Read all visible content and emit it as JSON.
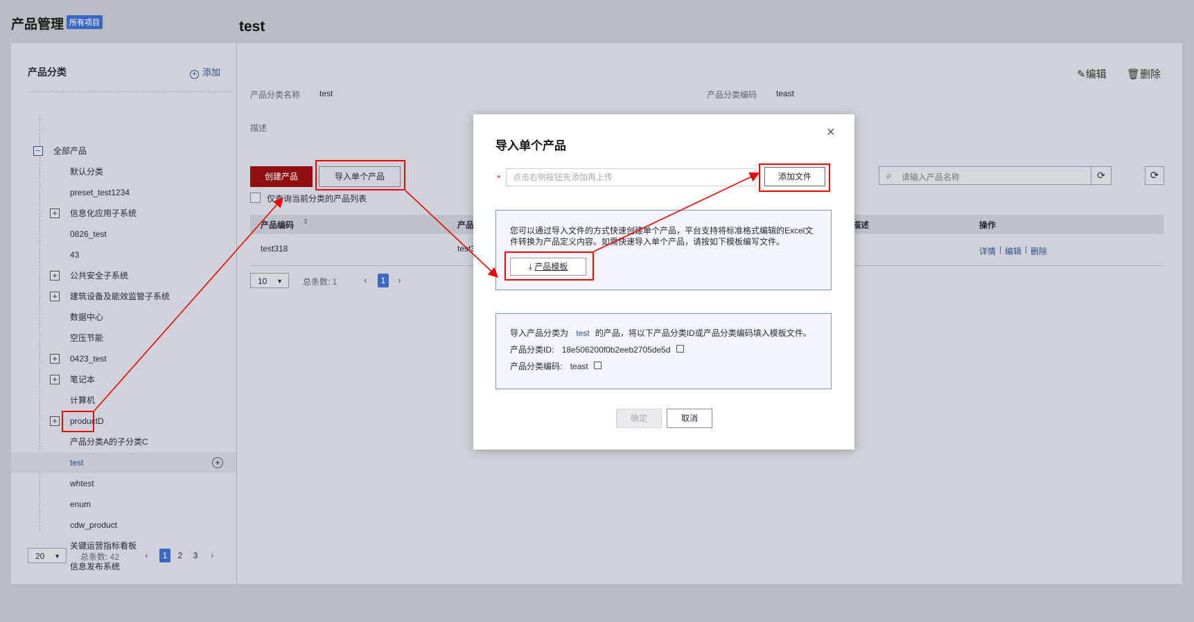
{
  "header": {
    "title": "产品管理",
    "badge": "所有项目"
  },
  "sidebar": {
    "title": "产品分类",
    "add_label": "添加",
    "tree": [
      {
        "label": "全部产品",
        "expander": "−",
        "root": true
      },
      {
        "label": "默认分类"
      },
      {
        "label": "preset_test1234"
      },
      {
        "label": "信息化应用子系统",
        "expander": "+"
      },
      {
        "label": "0826_test"
      },
      {
        "label": "43"
      },
      {
        "label": "公共安全子系统",
        "expander": "+"
      },
      {
        "label": "建筑设备及能效监管子系统",
        "expander": "+"
      },
      {
        "label": "数据中心"
      },
      {
        "label": "空压节能"
      },
      {
        "label": "0423_test",
        "expander": "+"
      },
      {
        "label": "笔记本",
        "expander": "+"
      },
      {
        "label": "计算机"
      },
      {
        "label": "productD",
        "expander": "+"
      },
      {
        "label": "产品分类A的子分类C"
      },
      {
        "label": "test",
        "selected": true
      },
      {
        "label": "whtest"
      },
      {
        "label": "enum"
      },
      {
        "label": "cdw_product"
      },
      {
        "label": "关键运营指标看板"
      },
      {
        "label": "信息发布系统"
      }
    ],
    "pager": {
      "size": "20",
      "total_label": "总条数: 42",
      "pages": [
        "1",
        "2",
        "3"
      ],
      "current": "1"
    }
  },
  "detail": {
    "title": "test",
    "edit_label": "编辑",
    "delete_label": "删除",
    "name_label": "产品分类名称",
    "name_value": "test",
    "code_label": "产品分类编码",
    "code_value": "teast",
    "desc_label": "描述",
    "create_btn": "创建产品",
    "import_btn": "导入单个产品",
    "only_current_label": "仅查询当前分类的产品列表",
    "search_placeholder": "请输入产品名称",
    "table": {
      "col_code": "产品编码",
      "col_name": "产品",
      "col_desc": "描述",
      "col_ops": "操作",
      "rows": [
        {
          "code": "test318",
          "name": "test3",
          "ops": [
            "详情",
            "编辑",
            "删除"
          ]
        }
      ]
    },
    "pager": {
      "size": "10",
      "total_label": "总条数: 1",
      "current": "1"
    }
  },
  "modal": {
    "title": "导入单个产品",
    "close": "×",
    "required_mark": "*",
    "file_placeholder": "点击右侧按钮先添加再上传",
    "add_file_btn": "添加文件",
    "info_line1": "您可以通过导入文件的方式快速创建单个产品，平台支持将标准格式编辑的Excel文",
    "info_line2": "件转换为产品定义内容。如需快速导入单个产品，请按如下模板编写文件。",
    "template_btn": "产品模板",
    "cat_prefix": "导入产品分类为",
    "cat_name": "test",
    "cat_suffix": "的产品，将以下产品分类ID或产品分类编码填入模板文件。",
    "id_label": "产品分类ID:",
    "id_value": "18e506200f0b2eeb2705de5d",
    "code_label": "产品分类编码:",
    "code_value": "teast",
    "ok_btn": "确定",
    "cancel_btn": "取消"
  },
  "colors": {
    "accent": "#3b68c4",
    "primary_red": "#8f0e0e",
    "highlight": "#ee0000"
  }
}
